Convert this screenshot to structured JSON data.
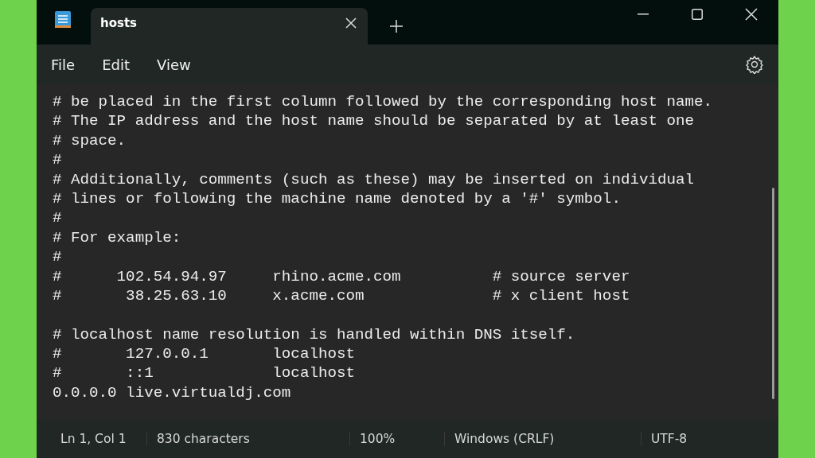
{
  "tabs": [
    {
      "title": "hosts",
      "selected": true
    }
  ],
  "menu": [
    "File",
    "Edit",
    "View"
  ],
  "editor": {
    "blocks": [
      [
        "# be placed in the first column followed by the corresponding host name.",
        "# The IP address and the host name should be separated by at least one",
        "# space.",
        "#",
        "# Additionally, comments (such as these) may be inserted on individual",
        "# lines or following the machine name denoted by a '#' symbol.",
        "#",
        "# For example:",
        "#",
        "#      102.54.94.97     rhino.acme.com          # source server",
        "#       38.25.63.10     x.acme.com              # x client host"
      ],
      [
        "# localhost name resolution is handled within DNS itself.",
        "#       127.0.0.1       localhost",
        "#       ::1             localhost",
        "0.0.0.0 live.virtualdj.com"
      ]
    ]
  },
  "status_bar": [
    "Ln 1, Col 1",
    "830 characters",
    "100%",
    "Windows (CRLF)",
    "UTF-8"
  ]
}
